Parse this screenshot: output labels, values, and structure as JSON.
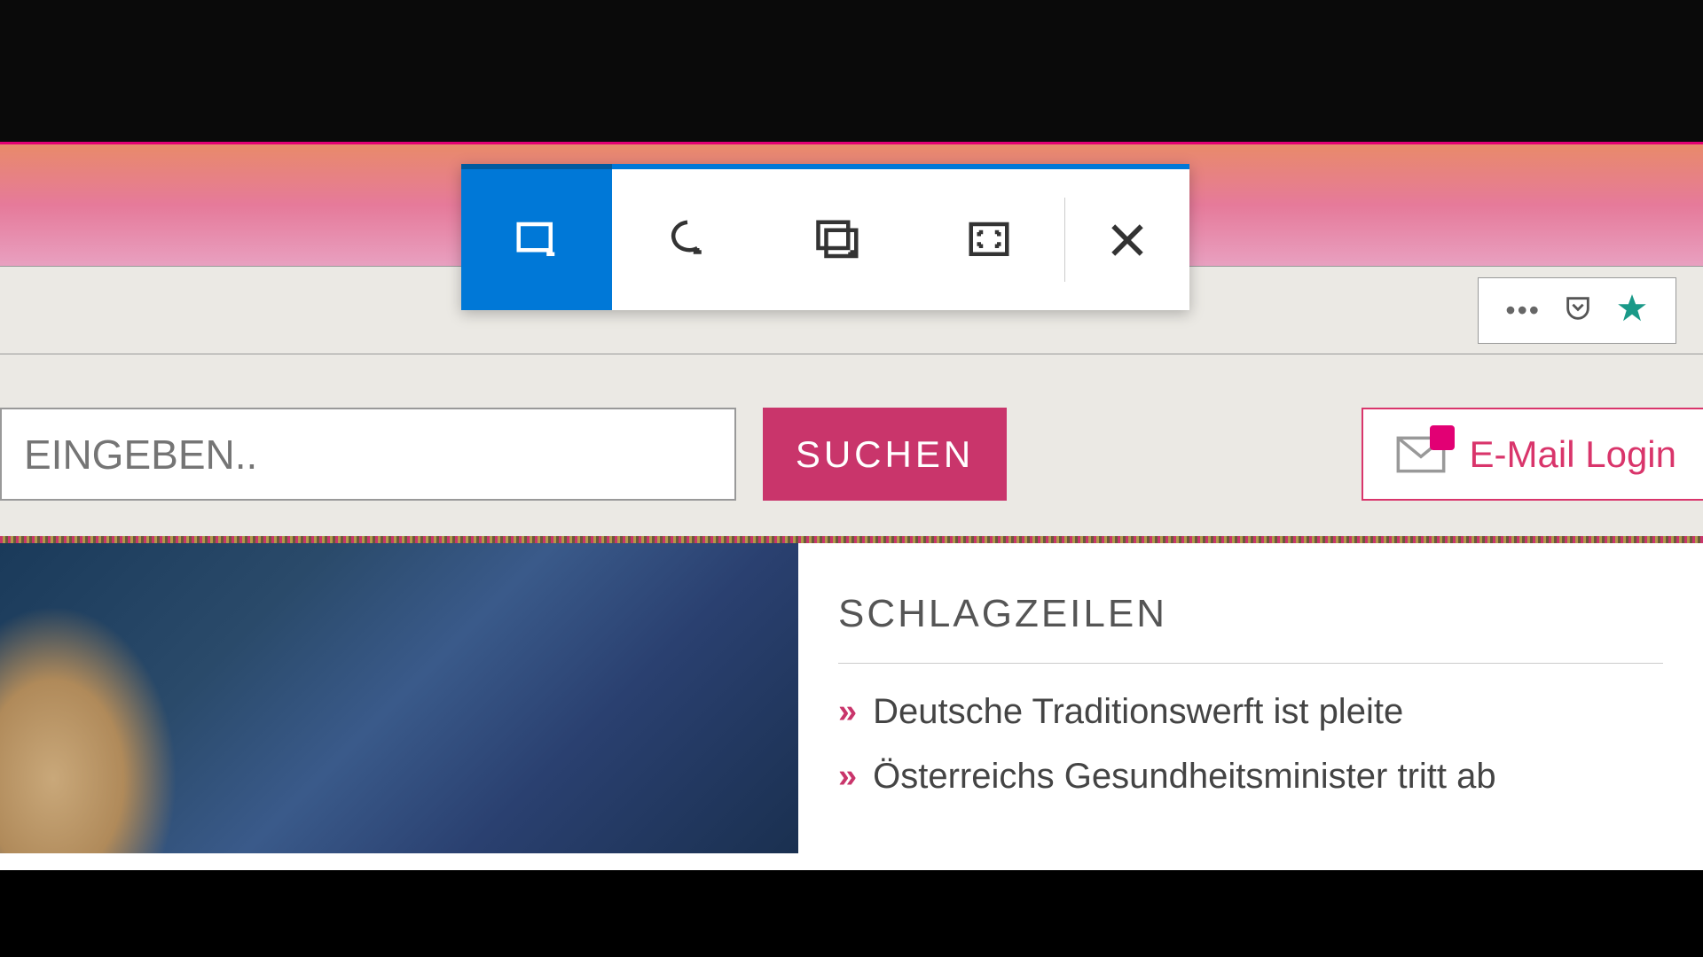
{
  "search": {
    "placeholder": "EINGEBEN..",
    "button_label": "SUCHEN"
  },
  "email_login": {
    "label": "E-Mail Login"
  },
  "headlines": {
    "title": "SCHLAGZEILEN",
    "items": [
      "Deutsche Traditionswerft ist pleite",
      "Österreichs Gesundheitsminister tritt ab"
    ]
  },
  "colors": {
    "magenta": "#c9356b",
    "active_blue": "#0078d7"
  }
}
